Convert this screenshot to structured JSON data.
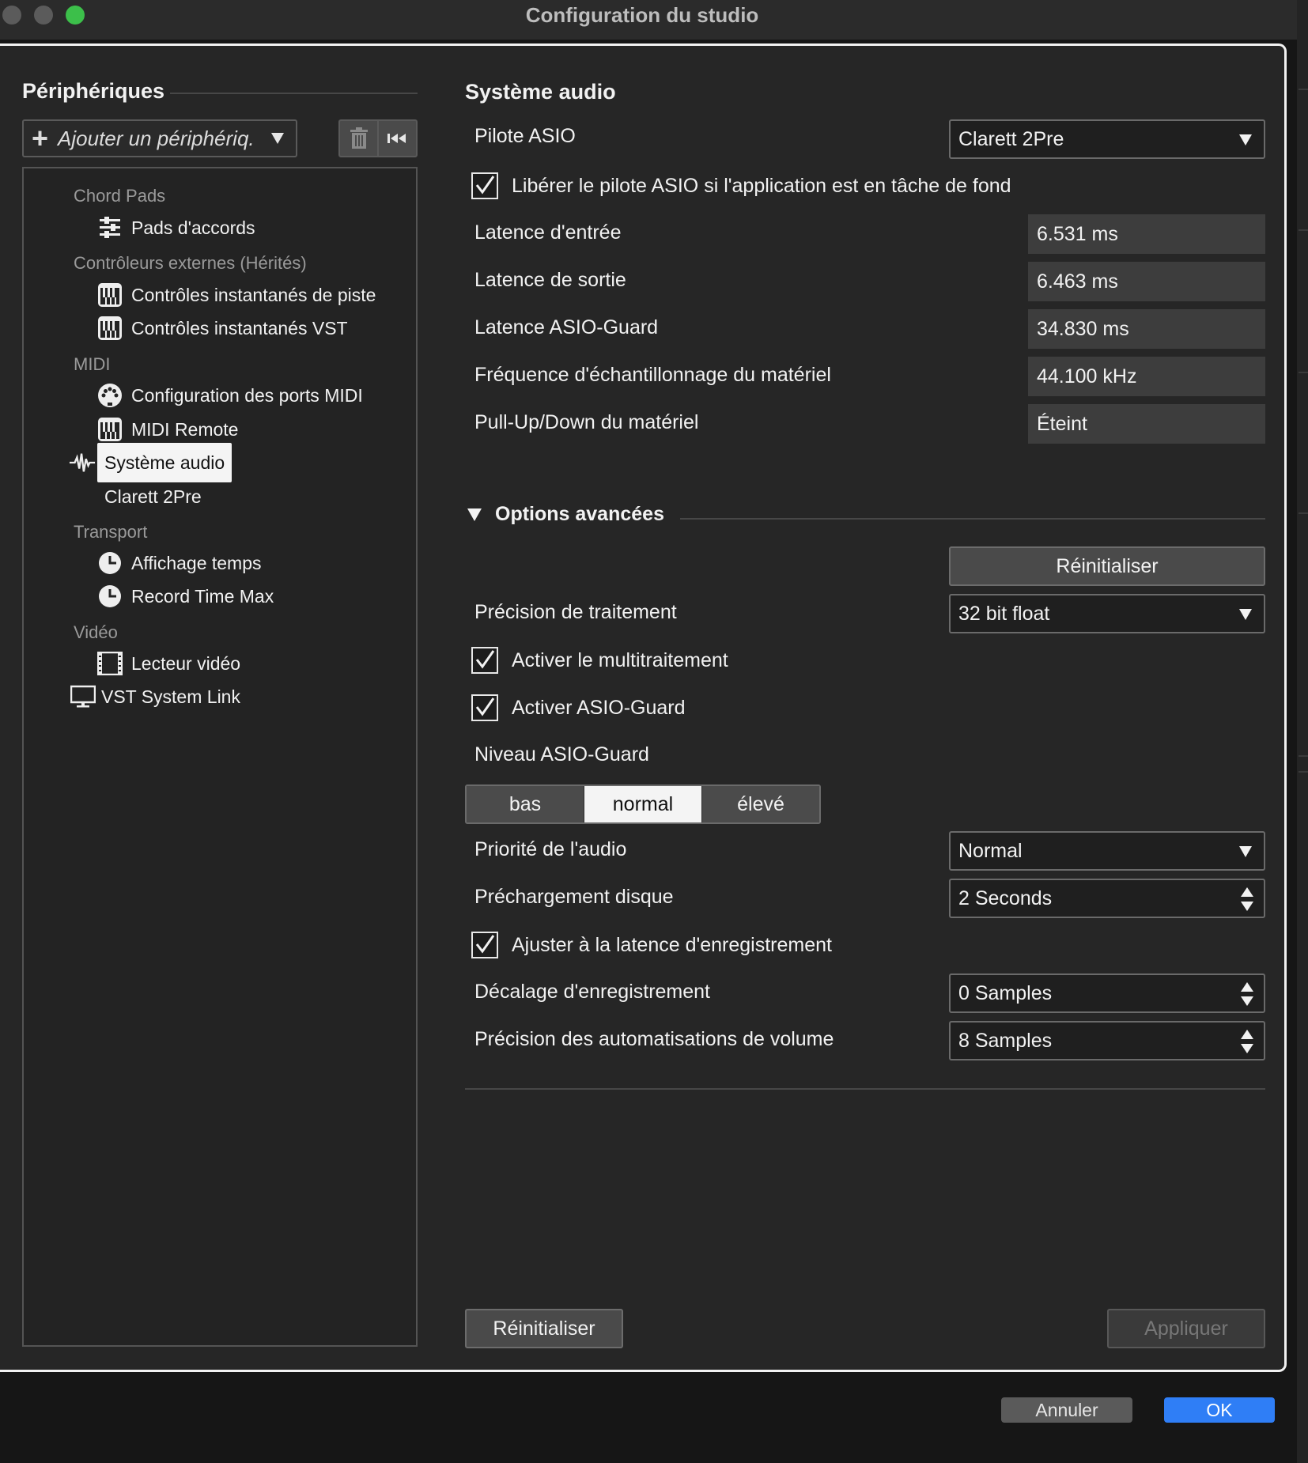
{
  "window": {
    "title": "Configuration du studio"
  },
  "devices": {
    "title": "Périphériques",
    "add_label": "Ajouter un périphériq.",
    "tree": {
      "chord_pads": {
        "category": "Chord Pads",
        "pads": "Pads d'accords"
      },
      "external": {
        "category": "Contrôleurs externes (Hérités)",
        "track_quick": "Contrôles instantanés de piste",
        "vst_quick": "Contrôles instantanés VST"
      },
      "midi": {
        "category": "MIDI",
        "ports": "Configuration des ports MIDI",
        "remote": "MIDI Remote"
      },
      "audio_system": "Système audio",
      "audio_device": "Clarett 2Pre",
      "transport": {
        "category": "Transport",
        "time_display": "Affichage temps",
        "record_time": "Record Time Max"
      },
      "video": {
        "category": "Vidéo",
        "player": "Lecteur vidéo"
      },
      "vst_link": "VST System Link"
    }
  },
  "audio": {
    "title": "Système audio",
    "asio_driver_label": "Pilote ASIO",
    "asio_driver_value": "Clarett 2Pre",
    "release_driver_label": "Libérer le pilote ASIO si l'application est en tâche de fond",
    "release_driver_checked": true,
    "input_latency_label": "Latence d'entrée",
    "input_latency_value": "6.531 ms",
    "output_latency_label": "Latence de sortie",
    "output_latency_value": "6.463 ms",
    "guard_latency_label": "Latence ASIO-Guard",
    "guard_latency_value": "34.830 ms",
    "sample_rate_label": "Fréquence d'échantillonnage du matériel",
    "sample_rate_value": "44.100 kHz",
    "pullupdown_label": "Pull-Up/Down du matériel",
    "pullupdown_value": "Éteint"
  },
  "advanced": {
    "title": "Options avancées",
    "reset_label": "Réinitialiser",
    "precision_label": "Précision de traitement",
    "precision_value": "32 bit float",
    "multiprocess_label": "Activer le multitraitement",
    "multiprocess_checked": true,
    "asioguard_label": "Activer ASIO-Guard",
    "asioguard_checked": true,
    "guard_level_label": "Niveau ASIO-Guard",
    "guard_levels": [
      "bas",
      "normal",
      "élevé"
    ],
    "guard_level_selected": "normal",
    "priority_label": "Priorité de l'audio",
    "priority_value": "Normal",
    "preload_label": "Préchargement disque",
    "preload_value": "2 Seconds",
    "adjust_latency_label": "Ajuster à la latence d'enregistrement",
    "adjust_latency_checked": true,
    "record_offset_label": "Décalage d'enregistrement",
    "record_offset_value": "0 Samples",
    "volume_precision_label": "Précision des automatisations de volume",
    "volume_precision_value": "8 Samples"
  },
  "footer": {
    "reset_label": "Réinitialiser",
    "apply_label": "Appliquer"
  },
  "dialog": {
    "cancel_label": "Annuler",
    "ok_label": "OK"
  },
  "colors": {
    "accent_blue": "#2f7ef6",
    "traffic_green": "#3cbf4a",
    "panel_bg": "#262626",
    "selected_bg": "#f4f4f4"
  }
}
